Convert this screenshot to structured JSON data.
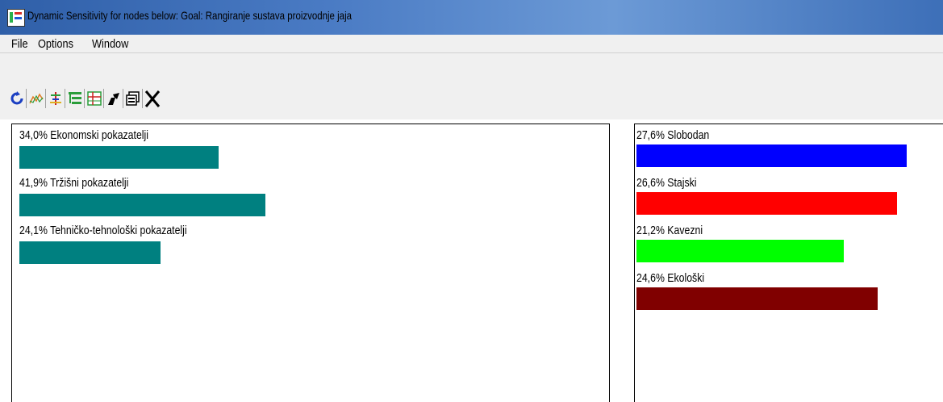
{
  "window": {
    "title": "Dynamic Sensitivity for nodes below: Goal: Rangiranje sustava proizvodnje jaja"
  },
  "menu": {
    "items": [
      "File",
      "Options",
      "Window"
    ]
  },
  "toolbar": {
    "buttons": [
      "refresh-icon",
      "chart-icon",
      "sensitivity-icon",
      "tree-icon",
      "grid-icon",
      "arrow-icon",
      "copy-icon",
      "close-icon"
    ]
  },
  "left_panel": {
    "rows": [
      {
        "label": "34,0% Ekonomski pokazatelji",
        "value": 34.0,
        "color": "#008080"
      },
      {
        "label": "41,9% Tržišni pokazatelji",
        "value": 41.9,
        "color": "#008080"
      },
      {
        "label": "24,1% Tehničko-tehnološki pokazatelji",
        "value": 24.1,
        "color": "#008080"
      }
    ]
  },
  "right_panel": {
    "rows": [
      {
        "label": "27,6% Slobodan",
        "value": 27.6,
        "color": "#0000ff"
      },
      {
        "label": "26,6% Stajski",
        "value": 26.6,
        "color": "#ff0000"
      },
      {
        "label": "21,2% Kavezni",
        "value": 21.2,
        "color": "#00ff00"
      },
      {
        "label": "24,6% Ekološki",
        "value": 24.6,
        "color": "#800000"
      }
    ]
  }
}
